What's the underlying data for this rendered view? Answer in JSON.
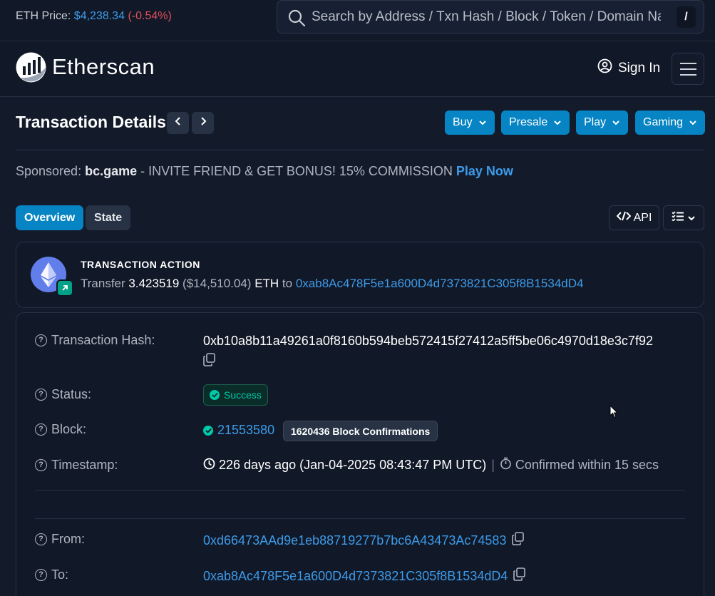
{
  "topbar": {
    "eth_price_label": "ETH Price:",
    "eth_price_value": "$4,238.34",
    "eth_price_change": "(-0.54%)",
    "search_placeholder": "Search by Address / Txn Hash / Block / Token / Domain Name",
    "search_shortcut": "/"
  },
  "navbar": {
    "brand": "Etherscan",
    "sign_in": "Sign In"
  },
  "page": {
    "title": "Transaction Details",
    "buttons": [
      "Buy",
      "Presale",
      "Play",
      "Gaming"
    ]
  },
  "sponsored": {
    "label": "Sponsored:",
    "sponsor": "bc.game",
    "text": " - INVITE FRIEND & GET BONUS! 15% COMMISSION ",
    "cta": "Play Now"
  },
  "tabs": {
    "overview": "Overview",
    "state": "State",
    "api": "API"
  },
  "action": {
    "title": "TRANSACTION ACTION",
    "verb": "Transfer",
    "amount": "3.423519",
    "usd": "($14,510.04)",
    "token": "ETH",
    "to_word": "to",
    "to_address": "0xab8Ac478F5e1a600D4d7373821C305f8B1534dD4"
  },
  "details": {
    "hash_label": "Transaction Hash:",
    "hash_value": "0xb10a8b11a49261a0f8160b594beb572415f27412a5ff5be06c4970d18e3c7f92",
    "status_label": "Status:",
    "status_value": "Success",
    "block_label": "Block:",
    "block_value": "21553580",
    "block_confirmations": "1620436 Block Confirmations",
    "timestamp_label": "Timestamp:",
    "timestamp_value": "226 days ago (Jan-04-2025 08:43:47 PM UTC)",
    "timestamp_sep": "|",
    "confirmed_within": "Confirmed within 15 secs",
    "from_label": "From:",
    "from_value": "0xd66473AAd9e1eb88719277b7bc6A43473Ac74583",
    "to_label": "To:",
    "to_value": "0xab8Ac478F5e1a600D4d7373821C305f8B1534dD4"
  },
  "colors": {
    "accent": "#0784c3",
    "link": "#3d9be9",
    "success": "#00c9a7",
    "negative": "#e0505a"
  }
}
